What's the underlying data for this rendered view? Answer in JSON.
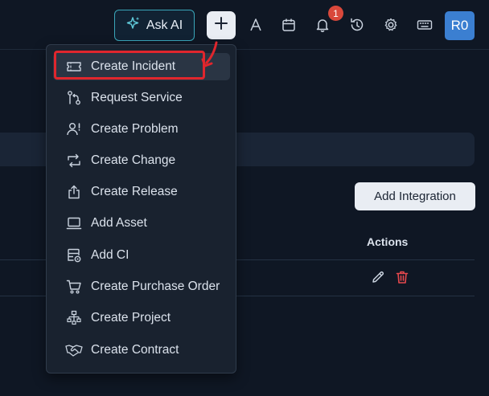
{
  "topbar": {
    "ask_ai_label": "Ask AI",
    "notification_count": "1",
    "avatar_initials": "R0"
  },
  "menu": {
    "items": [
      {
        "label": "Create Incident",
        "icon": "ticket-icon"
      },
      {
        "label": "Request Service",
        "icon": "service-request-icon"
      },
      {
        "label": "Create Problem",
        "icon": "problem-user-icon"
      },
      {
        "label": "Create Change",
        "icon": "change-arrows-icon"
      },
      {
        "label": "Create Release",
        "icon": "release-upload-icon"
      },
      {
        "label": "Add Asset",
        "icon": "laptop-icon"
      },
      {
        "label": "Add CI",
        "icon": "ci-server-icon"
      },
      {
        "label": "Create Purchase Order",
        "icon": "cart-icon"
      },
      {
        "label": "Create Project",
        "icon": "project-tree-icon"
      },
      {
        "label": "Create Contract",
        "icon": "handshake-icon"
      }
    ]
  },
  "main": {
    "add_integration_label": "Add Integration",
    "actions_header": "Actions"
  },
  "colors": {
    "background": "#0f1724",
    "menu_bg": "#19222f",
    "accent_teal": "#3aa6b9",
    "highlight_red": "#e0262d",
    "badge_red": "#d9483b",
    "avatar_blue": "#3b7fd1",
    "trash_red": "#e5484d"
  }
}
